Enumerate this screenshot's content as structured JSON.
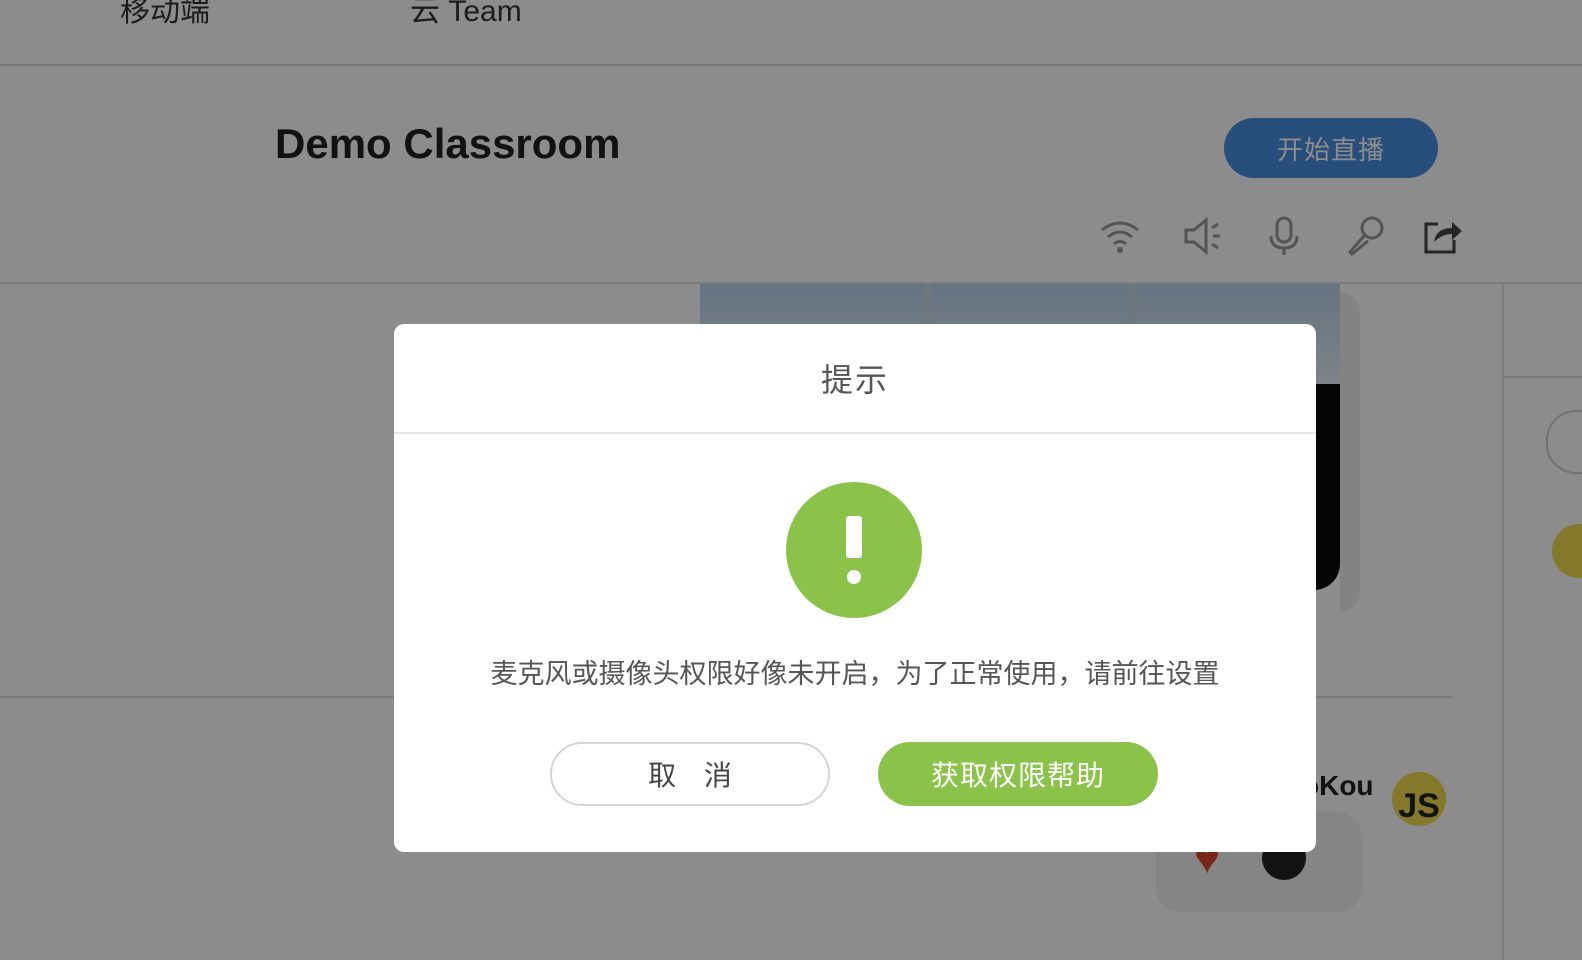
{
  "nav": {
    "item_mobile": "移动端",
    "item_team": "云 Team"
  },
  "header": {
    "room_title": "Demo Classroom",
    "start_live_label": "开始直播"
  },
  "toolbar": {
    "icons": [
      "wifi-icon",
      "speaker-icon",
      "microphone-icon",
      "mic-off-icon",
      "share-icon"
    ]
  },
  "chat": {
    "username": "oKou",
    "avatar_text": "JS"
  },
  "modal": {
    "title": "提示",
    "message": "麦克风或摄像头权限好像未开启，为了正常使用，请前往设置",
    "cancel_label": "取 消",
    "help_label": "获取权限帮助",
    "icon": "exclamation-icon"
  },
  "colors": {
    "accent_green": "#8bc34a",
    "primary_blue": "#4a90e2",
    "overlay": "rgba(0,0,0,0.45)"
  }
}
